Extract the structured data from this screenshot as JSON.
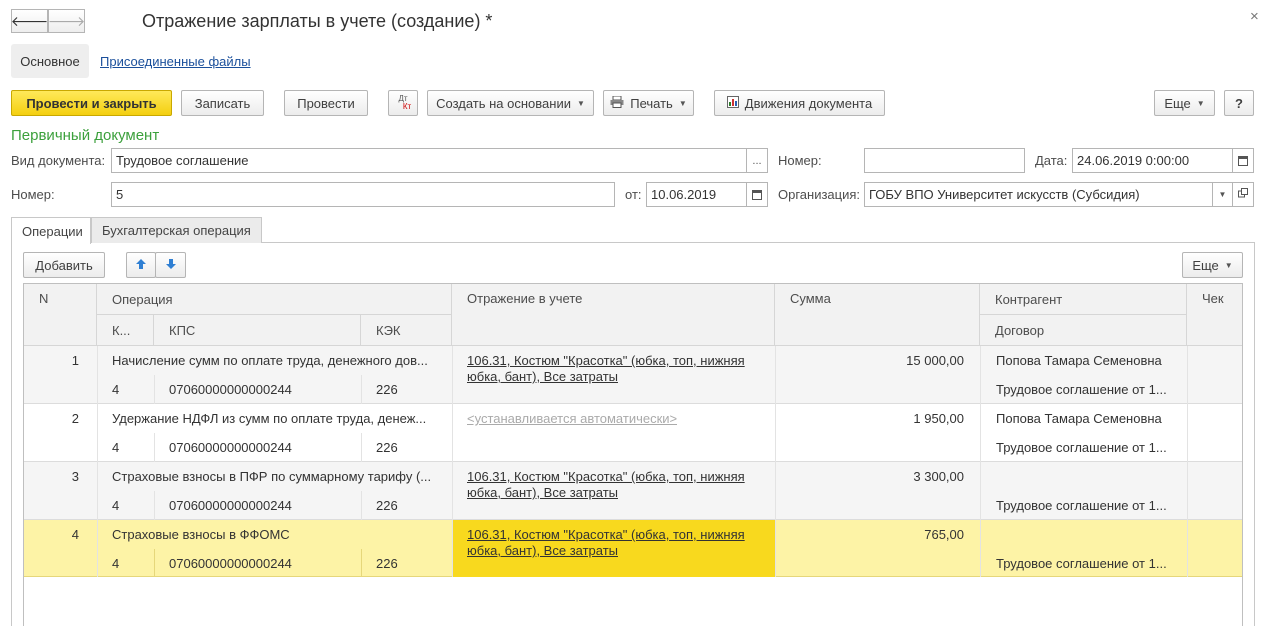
{
  "window": {
    "title": "Отражение зарплаты в учете (создание) *",
    "close_glyph": "×",
    "back_glyph": "🡐",
    "forward_glyph": "🡒"
  },
  "nav": {
    "main": "Основное",
    "attached": "Присоединенные файлы"
  },
  "toolbar": {
    "post_close": "Провести и закрыть",
    "save": "Записать",
    "post": "Провести",
    "dtkt_top": "Дт",
    "dtkt_bottom": "Кт",
    "create_based": "Создать на основании",
    "print": "Печать",
    "movements": "Движения документа",
    "more": "Еще",
    "help": "?"
  },
  "section_title": "Первичный документ",
  "form": {
    "doc_type_label": "Вид документа:",
    "doc_type_value": "Трудовое соглашение",
    "number_label_top": "Номер:",
    "number_top_value": "",
    "date_label": "Дата:",
    "date_value": "24.06.2019  0:00:00",
    "number_label": "Номер:",
    "number_value": "5",
    "from_label": "от:",
    "from_value": "10.06.2019",
    "org_label": "Организация:",
    "org_value": "ГОБУ ВПО Университет искусств (Субсидия)",
    "ellipsis": "..."
  },
  "tabs": {
    "operations": "Операции",
    "accounting": "Бухгалтерская операция"
  },
  "table_toolbar": {
    "add": "Добавить",
    "more": "Еще"
  },
  "columns": {
    "n": "N",
    "operation": "Операция",
    "k": "К...",
    "kps": "КПС",
    "kek": "КЭК",
    "reflection": "Отражение в учете",
    "sum": "Сумма",
    "counterparty": "Контрагент",
    "contract": "Договор",
    "check": "Чек"
  },
  "rows": [
    {
      "n": "1",
      "operation": "Начисление сумм по оплате труда, денежного дов...",
      "k": "4",
      "kps": "07060000000000244",
      "kek": "226",
      "reflection_1": "106.31, Костюм \"Красотка\" (юбка, топ, нижняя",
      "reflection_2": "юбка, бант), Все затраты",
      "sum": "15 000,00",
      "counterparty": "Попова Тамара Семеновна",
      "contract": "Трудовое соглашение от 1..."
    },
    {
      "n": "2",
      "operation": "Удержание НДФЛ из сумм по оплате труда, денеж...",
      "k": "4",
      "kps": "07060000000000244",
      "kek": "226",
      "reflection_1": "<устанавливается автоматически>",
      "reflection_2": "",
      "sum": "1 950,00",
      "counterparty": "Попова Тамара Семеновна",
      "contract": "Трудовое соглашение от 1..."
    },
    {
      "n": "3",
      "operation": "Страховые взносы в ПФР по суммарному тарифу (...",
      "k": "4",
      "kps": "07060000000000244",
      "kek": "226",
      "reflection_1": "106.31, Костюм \"Красотка\" (юбка, топ, нижняя",
      "reflection_2": "юбка, бант), Все затраты",
      "sum": "3 300,00",
      "counterparty": "",
      "contract": "Трудовое соглашение от 1..."
    },
    {
      "n": "4",
      "operation": "Страховые взносы в ФФОМС",
      "k": "4",
      "kps": "07060000000000244",
      "kek": "226",
      "reflection_1": "106.31, Костюм \"Красотка\" (юбка, топ, нижняя",
      "reflection_2": "юбка, бант), Все затраты",
      "sum": "765,00",
      "counterparty": "",
      "contract": "Трудовое соглашение от 1..."
    }
  ],
  "colors": {
    "primary_button": "#f4cf10",
    "selected_row": "#fdf3a6",
    "selected_cell": "#f8d91e",
    "section_title": "#3ca03c",
    "link": "#1a4f9b"
  }
}
